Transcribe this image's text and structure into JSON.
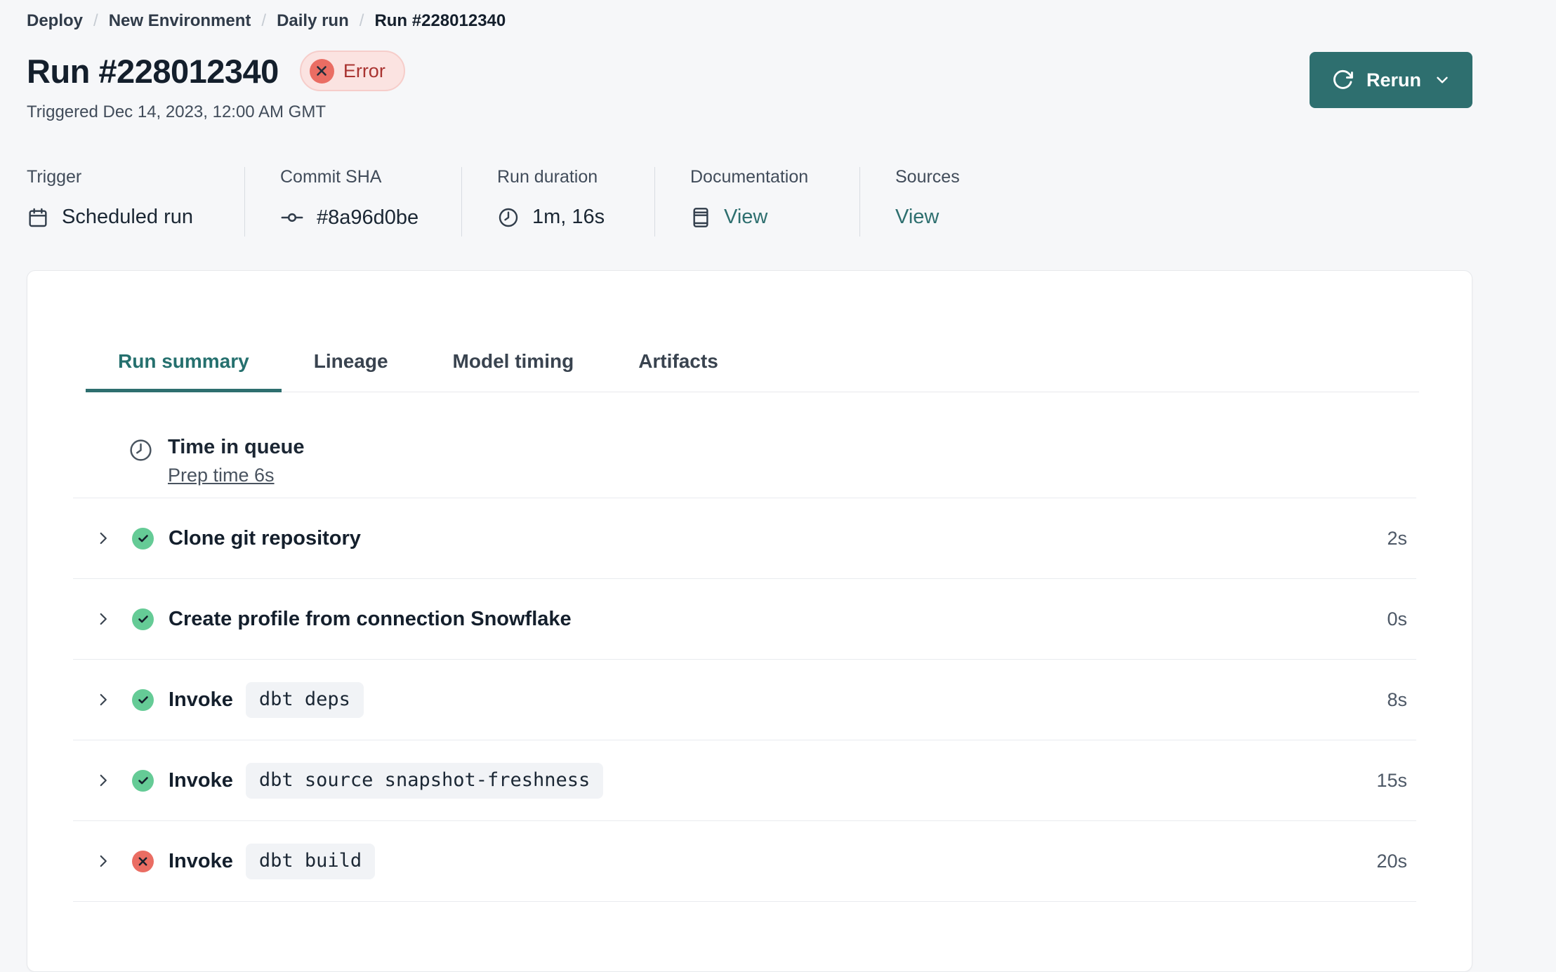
{
  "colors": {
    "accent_teal": "#2E6F6F",
    "success_green": "#65CB96",
    "error_red": "#EA6D63",
    "error_badge_bg": "#FBE3E1",
    "error_badge_border": "#F6CDCA",
    "error_badge_text": "#A93330",
    "dark_text": "#141F2C",
    "gray_text": "#4D5866"
  },
  "breadcrumb": {
    "separator": "/",
    "items": [
      "Deploy",
      "New Environment",
      "Daily run"
    ],
    "current": "Run #228012340"
  },
  "header": {
    "title": "Run #228012340",
    "status_badge": "Error",
    "triggered": "Triggered Dec 14, 2023, 12:00 AM GMT",
    "rerun_label": "Rerun"
  },
  "meta": {
    "trigger": {
      "label": "Trigger",
      "value": "Scheduled run",
      "icon": "calendar-icon"
    },
    "commit_sha": {
      "label": "Commit SHA",
      "value": "#8a96d0be",
      "icon": "commit-icon"
    },
    "run_duration": {
      "label": "Run duration",
      "value": "1m, 16s",
      "icon": "clock-icon"
    },
    "documentation": {
      "label": "Documentation",
      "link_label": "View",
      "icon": "docs-icon"
    },
    "sources": {
      "label": "Sources",
      "link_label": "View"
    }
  },
  "tabs": [
    {
      "label": "Run summary",
      "active": true
    },
    {
      "label": "Lineage",
      "active": false
    },
    {
      "label": "Model timing",
      "active": false
    },
    {
      "label": "Artifacts",
      "active": false
    }
  ],
  "queue": {
    "title": "Time in queue",
    "link_label": "Prep time 6s",
    "icon": "clock-icon"
  },
  "steps": [
    {
      "status": "success",
      "title": "Clone git repository",
      "command": "",
      "duration": "2s"
    },
    {
      "status": "success",
      "title": "Create profile from connection Snowflake",
      "command": "",
      "duration": "0s"
    },
    {
      "status": "success",
      "title": "Invoke",
      "command": "dbt deps",
      "duration": "8s"
    },
    {
      "status": "success",
      "title": "Invoke",
      "command": "dbt source snapshot-freshness",
      "duration": "15s"
    },
    {
      "status": "error",
      "title": "Invoke",
      "command": "dbt build",
      "duration": "20s"
    }
  ]
}
